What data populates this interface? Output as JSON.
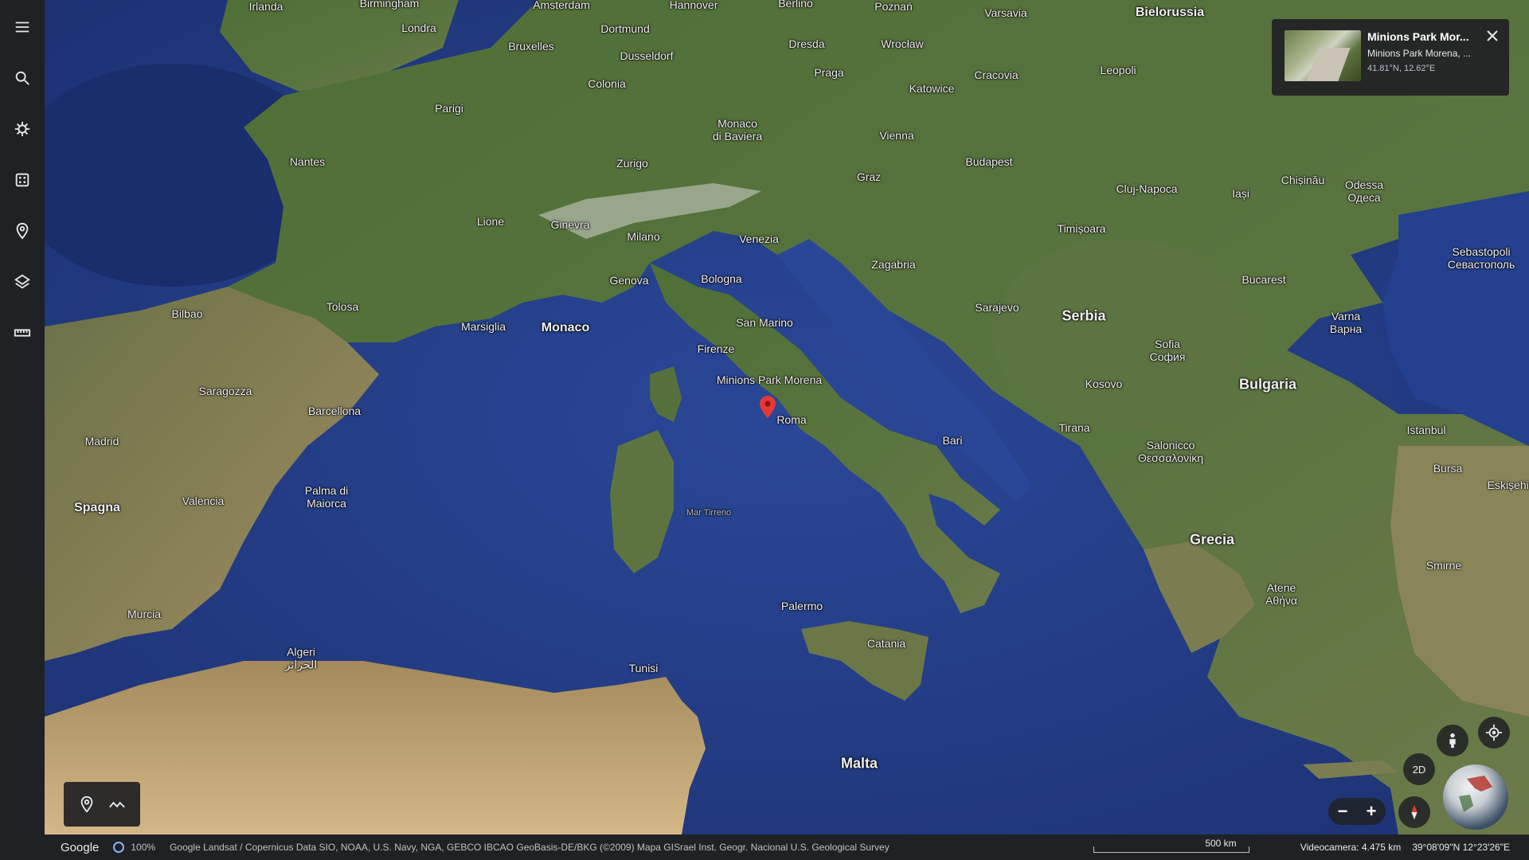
{
  "sidebar": {
    "items": [
      {
        "name": "menu",
        "icon": "menu-icon"
      },
      {
        "name": "search",
        "icon": "search-icon"
      },
      {
        "name": "voyager",
        "icon": "voyager-wheel-icon"
      },
      {
        "name": "feeling-lucky",
        "icon": "dice-icon"
      },
      {
        "name": "projects",
        "icon": "pin-icon"
      },
      {
        "name": "map-style",
        "icon": "layers-icon"
      },
      {
        "name": "measure",
        "icon": "ruler-icon"
      }
    ]
  },
  "map_labels": {
    "irlanda": "Irlanda",
    "birmingham": "Birmingham",
    "amsterdam": "Amsterdam",
    "hannover": "Hannover",
    "berlino": "Berlino",
    "poznan": "Poznań",
    "varsavia": "Varsavia",
    "bielorussia": "Bielorussia",
    "londra": "Londra",
    "dortmund": "Dortmund",
    "bruxelles": "Bruxelles",
    "dresda": "Dresda",
    "wroclaw": "Wrocław",
    "dusseldorf": "Dusseldorf",
    "praga": "Praga",
    "cracovia": "Cracovia",
    "leopoli": "Leopoli",
    "colonia": "Colonia",
    "katowice": "Katowice",
    "parigi": "Parigi",
    "monaco_baviera": "Monaco\ndi Baviera",
    "vienna": "Vienna",
    "budapest": "Budapest",
    "nantes": "Nantes",
    "zurigo": "Zurigo",
    "graz": "Graz",
    "cluj": "Cluj-Napoca",
    "chisinau": "Chișinău",
    "odessa": "Odessa\nОдеса",
    "iasi": "Iași",
    "lione": "Lione",
    "ginevra": "Ginevra",
    "milano": "Milano",
    "venezia": "Venezia",
    "zagabria": "Zagabria",
    "timisoara": "Timișoara",
    "sebastopoli": "Sebastopoli\nСевастополь",
    "genova": "Genova",
    "bologna": "Bologna",
    "bucarest": "Bucarest",
    "bilbao": "Bilbao",
    "tolosa": "Tolosa",
    "marsiglia": "Marsiglia",
    "monaco": "Monaco",
    "san_marino": "San Marino",
    "sarajevo": "Sarajevo",
    "serbia": "Serbia",
    "varna": "Varna\nВарна",
    "firenze": "Firenze",
    "sofia": "Sofia\nСофия",
    "minions": "Minions Park Morena",
    "kosovo": "Kosovo",
    "bulgaria": "Bulgaria",
    "saragozza": "Saragozza",
    "barcellona": "Barcellona",
    "roma": "Roma",
    "tirana": "Tirana",
    "bari": "Bari",
    "istanbul": "Istanbul",
    "salonicco": "Salonicco\nΘεσσαλονίκη",
    "madrid": "Madrid",
    "bursa": "Bursa",
    "eskisehir": "Eskişehir",
    "palma": "Palma di\nMaiorca",
    "valencia": "Valencia",
    "spagna": "Spagna",
    "grecia": "Grecia",
    "mar_tirreno": "Mar Tirreno",
    "smirne": "Smirne",
    "murcia": "Murcia",
    "palermo": "Palermo",
    "atene": "Atene\nΑθήνα",
    "catania": "Catania",
    "algeri": "Algeri\nالجزائر",
    "tunisi": "Tunisi",
    "malta": "Malta"
  },
  "info_card": {
    "title": "Minions Park Mor...",
    "subtitle": "Minions Park Morena, ...",
    "coords": "41.81°N, 12.62°E"
  },
  "controls": {
    "toggle_2d": "2D",
    "zoom_out": "−",
    "zoom_in": "+"
  },
  "statusbar": {
    "logo": "Google",
    "loading": "100%",
    "attribution": "Google   Landsat / Copernicus   Data SIO, NOAA, U.S. Navy, NGA, GEBCO   IBCAO   GeoBasis-DE/BKG (©2009)   Mapa GISrael   Inst. Geogr. Nacional   U.S. Geological Survey",
    "scale": "500 km",
    "camera": "Videocamera: 4.475 km",
    "coordinates": "39°08'09\"N 12°23'26\"E"
  },
  "colors": {
    "sea": "#27408a",
    "sea_deep": "#1c2f6e",
    "land_green": "#4b6a33",
    "land_dark": "#3a5628",
    "desert": "#c9ab7d",
    "ui_dark": "#202124",
    "pin": "#e53935"
  }
}
